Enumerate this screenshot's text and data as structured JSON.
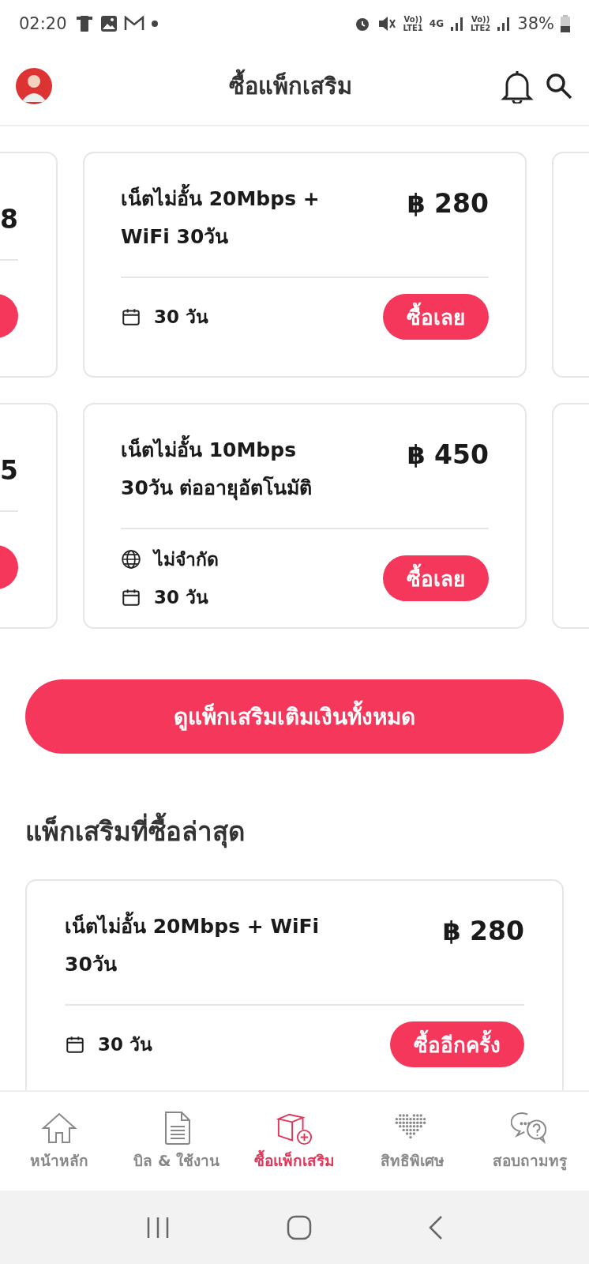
{
  "status_bar": {
    "time": "02:20",
    "sim1": [
      "Vo))",
      "LTE1"
    ],
    "network": "4G",
    "sim2": [
      "Vo))",
      "LTE2"
    ],
    "battery": "38%"
  },
  "header": {
    "title": "ซื้อแพ็กเสริม"
  },
  "carousel_rows": [
    {
      "left_price": "8",
      "card": {
        "name": "เน็ตไม่อั้น 20Mbps + WiFi 30วัน",
        "price": "฿ 280",
        "details": [
          {
            "kind": "calendar",
            "text": "30 วัน"
          }
        ],
        "button": "ซื้อเลย"
      }
    },
    {
      "left_price": "5",
      "card": {
        "name": "เน็ตไม่อั้น 10Mbps 30วัน ต่ออายุอัตโนมัติ",
        "price": "฿ 450",
        "details": [
          {
            "kind": "globe",
            "text": "ไม่จำกัด"
          },
          {
            "kind": "calendar",
            "text": "30 วัน"
          }
        ],
        "button": "ซื้อเลย"
      }
    }
  ],
  "view_all_button": "ดูแพ็กเสริมเติมเงินทั้งหมด",
  "recent": {
    "title": "แพ็กเสริมที่ซื้อล่าสุด",
    "card": {
      "name": "เน็ตไม่อั้น 20Mbps + WiFi 30วัน",
      "price": "฿ 280",
      "details": [
        {
          "kind": "calendar",
          "text": "30 วัน"
        }
      ],
      "button": "ซื้ออีกครั้ง"
    }
  },
  "bottom_nav": [
    {
      "kind": "home",
      "label": "หน้าหลัก",
      "selected": false
    },
    {
      "kind": "bill",
      "label": "บิล & ใช้งาน",
      "selected": false
    },
    {
      "kind": "box",
      "label": "ซื้อแพ็กเสริม",
      "selected": true
    },
    {
      "kind": "heart",
      "label": "สิทธิพิเศษ",
      "selected": false
    },
    {
      "kind": "chat",
      "label": "สอบถามทรู",
      "selected": false
    }
  ]
}
